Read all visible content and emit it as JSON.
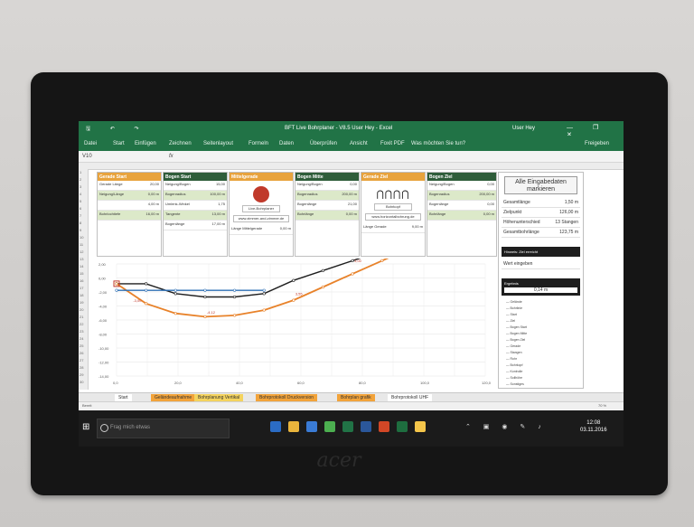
{
  "window": {
    "title": "BFT Live Bohrplaner - V8.5 User Hey - Excel",
    "user": "User Hey",
    "quick_access": "🖫 ↶ ↷",
    "controls": "—  ❐  ✕",
    "share": "Freigeben"
  },
  "ribbon_tabs": [
    "Datei",
    "Start",
    "Einfügen",
    "Zeichnen",
    "Seitenlayout",
    "Formeln",
    "Daten",
    "Überprüfen",
    "Ansicht",
    "Foxit PDF",
    "Was möchten Sie tun?"
  ],
  "formula": {
    "name_box": "V10",
    "fx": "fx"
  },
  "panels": [
    {
      "title": "Gerade Start",
      "rows": [
        {
          "k": "Gerade Länge",
          "v": "20,00"
        },
        {
          "k": "Neigung/Länge",
          "v": "0,00 m"
        },
        {
          "k": "",
          "v": "4,00 m"
        },
        {
          "k": "Bohrlochtiefe",
          "v": "16,00 m"
        }
      ]
    },
    {
      "title": "Bogen Start",
      "rows": [
        {
          "k": "Neigung/Bogen",
          "v": "15,00"
        },
        {
          "k": "Bogenradius",
          "v": "100,00 m"
        },
        {
          "k": "Umlenk-Winkel",
          "v": "1,75"
        },
        {
          "k": "Tangente",
          "v": "13,00 m"
        },
        {
          "k": "Bogenlänge",
          "v": "17,00 m"
        }
      ]
    },
    {
      "title": "Mittelgerade",
      "rows": [
        {
          "k": "Länge Mittelgerade",
          "v": "0,00 m"
        }
      ],
      "link": "www.zimmer-and-zimmer.de",
      "logo_text": "Live-Bohrplaner"
    },
    {
      "title": "Bogen Mitte",
      "rows": [
        {
          "k": "Neigung/Bogen",
          "v": "0,00"
        },
        {
          "k": "Bogenradius",
          "v": "200,00 m"
        },
        {
          "k": "Bogenlänge",
          "v": "21,00"
        },
        {
          "k": "Bohrlänge",
          "v": "0,00 m"
        }
      ]
    },
    {
      "title": "Gerade Ziel",
      "rows": [
        {
          "k": "Länge Gerade",
          "v": "9,00 m"
        }
      ],
      "link": "www.horizontalbohrung.de",
      "badge": "Bohrkopf"
    },
    {
      "title": "Bogen Ziel",
      "rows": [
        {
          "k": "Neigung/Bogen",
          "v": "0,00"
        },
        {
          "k": "Bogenradius",
          "v": "200,00 m"
        },
        {
          "k": "Bogenlänge",
          "v": "0,00"
        },
        {
          "k": "Bohrlänge",
          "v": "0,00 m"
        }
      ]
    }
  ],
  "side": {
    "button": "Alle Eingabedaten markieren",
    "rows": [
      {
        "k": "Gesamtlänge",
        "v": "1,50 m"
      },
      {
        "k": "Zielpunkt",
        "v": "126,00 m"
      },
      {
        "k": "Höhenunterschied",
        "v": "13 Stangen"
      },
      {
        "k": "Gesamtbohrlänge",
        "v": "123,75 m"
      }
    ],
    "hint": "Hinweis: Ziel erreicht",
    "input_label": "Wert eingeben",
    "result_title": "Ergebnis",
    "result_value": "0,14 m",
    "legend_items": [
      "Gelände",
      "Bohrlinie",
      "Start",
      "Ziel",
      "Bogen Start",
      "Bogen Mitte",
      "Bogen Ziel",
      "Gerade",
      "Stangen",
      "Rohr",
      "Bohrkopf",
      "Kontrolle",
      "Sollhöhe",
      "Sonstiges"
    ]
  },
  "chart_data": {
    "type": "line",
    "title": "",
    "xlabel": "",
    "ylabel": "",
    "x": [
      0,
      10,
      20,
      30,
      40,
      50,
      60,
      70,
      80,
      90,
      100,
      110,
      120,
      125
    ],
    "ylim": [
      -14,
      3
    ],
    "y_ticks": [
      "2,00",
      "0,00",
      "-2,00",
      "-4,00",
      "-6,00",
      "-8,00",
      "-10,00",
      "-12,00",
      "-14,00"
    ],
    "x_ticks": [
      "0,0",
      "20,0",
      "40,0",
      "60,0",
      "80,0",
      "100,0",
      "120,0"
    ],
    "series": [
      {
        "name": "Gelände",
        "color": "#1f1f1f",
        "values": [
          0,
          0,
          -1.5,
          -2,
          -2,
          -1.5,
          0.5,
          2,
          3.5,
          5,
          6.5,
          7.5,
          8,
          9
        ]
      },
      {
        "name": "Bohrlinie",
        "color": "#e8822a",
        "values": [
          0,
          -3,
          -4.5,
          -5,
          -4.8,
          -4,
          -2.5,
          -0.5,
          1.5,
          3.5,
          5.5,
          6.5,
          7.5,
          8
        ]
      },
      {
        "name": "Leitung",
        "color": "#2d6fb5",
        "values": [
          -1,
          -1,
          -1,
          -1,
          -1,
          -1,
          null,
          null,
          null,
          null,
          null,
          null,
          null,
          null
        ]
      }
    ],
    "labels": [
      "-3,00",
      "-4,12",
      "3,00",
      "7,00",
      "3,55"
    ]
  },
  "sheet_tabs": [
    {
      "label": "Start",
      "cls": "w"
    },
    {
      "label": "Geländeaufnahme",
      "cls": "o"
    },
    {
      "label": "Bohrplanung Vertikal",
      "cls": "y"
    },
    {
      "label": "Bohrprotokoll Druckversion",
      "cls": "o"
    },
    {
      "label": "Bohrplan grafik",
      "cls": "o"
    },
    {
      "label": "Bohrprotokoll UHF",
      "cls": "w"
    }
  ],
  "status": {
    "left": "Bereit",
    "zoom": "70 %"
  },
  "taskbar": {
    "search": "Frag mich etwas",
    "time": "12:08",
    "date": "03.11.2016"
  },
  "hardware": {
    "brand": "acer"
  }
}
